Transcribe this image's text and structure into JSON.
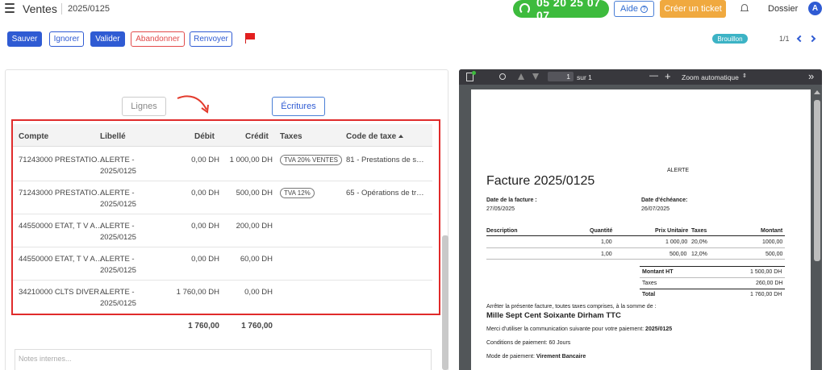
{
  "header": {
    "app_title": "Ventes",
    "record_ref": "2025/0125",
    "phone": "05 20 25 07 07",
    "help_label": "Aide",
    "help_glyph": "?",
    "ticket_label": "Créer un ticket",
    "dossier_label": "Dossier",
    "avatar_initial": "A"
  },
  "toolbar": {
    "save_label": "Sauver",
    "ignore_label": "Ignorer",
    "validate_label": "Valider",
    "abandon_label": "Abandonner",
    "resend_label": "Renvoyer",
    "status": "Brouillon",
    "pager": "1/1"
  },
  "tabs": {
    "lines_label": "Lignes",
    "entries_label": "Écritures"
  },
  "entries_table": {
    "headers": {
      "account": "Compte",
      "label": "Libellé",
      "debit": "Débit",
      "credit": "Crédit",
      "taxes": "Taxes",
      "tax_code": "Code de taxe"
    },
    "rows": [
      {
        "account": "71243000 PRESTATIO…",
        "label1": "ALERTE -",
        "label2": "2025/0125",
        "debit": "0,00 DH",
        "credit": "1 000,00 DH",
        "tax": "TVA 20% VENTES",
        "tax_code": "81 - Prestations de s…"
      },
      {
        "account": "71243000 PRESTATIO…",
        "label1": "ALERTE -",
        "label2": "2025/0125",
        "debit": "0,00 DH",
        "credit": "500,00 DH",
        "tax": "TVA 12%",
        "tax_code": "65 - Opérations de tr…"
      },
      {
        "account": "44550000 ETAT, T V A…",
        "label1": "ALERTE -",
        "label2": "2025/0125",
        "debit": "0,00 DH",
        "credit": "200,00 DH",
        "tax": "",
        "tax_code": ""
      },
      {
        "account": "44550000 ETAT, T V A…",
        "label1": "ALERTE -",
        "label2": "2025/0125",
        "debit": "0,00 DH",
        "credit": "60,00 DH",
        "tax": "",
        "tax_code": ""
      },
      {
        "account": "34210000 CLTS DIVER…",
        "label1": "ALERTE -",
        "label2": "2025/0125",
        "debit": "1 760,00 DH",
        "credit": "0,00 DH",
        "tax": "",
        "tax_code": ""
      }
    ],
    "total_debit": "1 760,00",
    "total_credit": "1 760,00"
  },
  "notes_placeholder": "Notes internes...",
  "pdf_viewer": {
    "page_current": "1",
    "page_total_label": "sur 1",
    "zoom_label": "Zoom automatique",
    "minus": "—",
    "plus": "+",
    "more": "»"
  },
  "invoice": {
    "company": "ALERTE",
    "title": "Facture 2025/0125",
    "invoice_date_label": "Date de la facture :",
    "invoice_date": "27/05/2025",
    "due_date_label": "Date d'échéance:",
    "due_date": "26/07/2025",
    "columns": {
      "description": "Description",
      "quantity": "Quantité",
      "unit_price": "Prix Unitaire",
      "taxes": "Taxes",
      "amount": "Montant"
    },
    "lines": [
      {
        "quantity": "1,00",
        "unit_price": "1 000,00",
        "tax": "20,0%",
        "amount": "1000,00"
      },
      {
        "quantity": "1,00",
        "unit_price": "500,00",
        "tax": "12,0%",
        "amount": "500,00"
      }
    ],
    "totals": {
      "ht_label": "Montant HT",
      "ht_value": "1 500,00 DH",
      "taxes_label": "Taxes",
      "taxes_value": "260,00 DH",
      "total_label": "Total",
      "total_value": "1 760,00 DH"
    },
    "amount_words_intro": "Arrêter la présente facture, toutes taxes comprises, à la somme de :",
    "amount_words": "Mille Sept Cent Soixante Dirham TTC",
    "payment_ref_label": "Merci d'utiliser la communication suivante pour votre paiement:",
    "payment_ref": "2025/0125",
    "terms": "Conditions de paiement: 60 Jours",
    "payment_mode_label": "Mode de paiement:",
    "payment_mode": "Virement Bancaire"
  },
  "colors": {
    "primary": "#2f5bd3",
    "danger": "#e24b4b",
    "phone_green": "#3dbb3d",
    "ticket_orange": "#f0a93f",
    "status_teal": "#3cb3c5",
    "highlight_red": "#e02b2b"
  }
}
